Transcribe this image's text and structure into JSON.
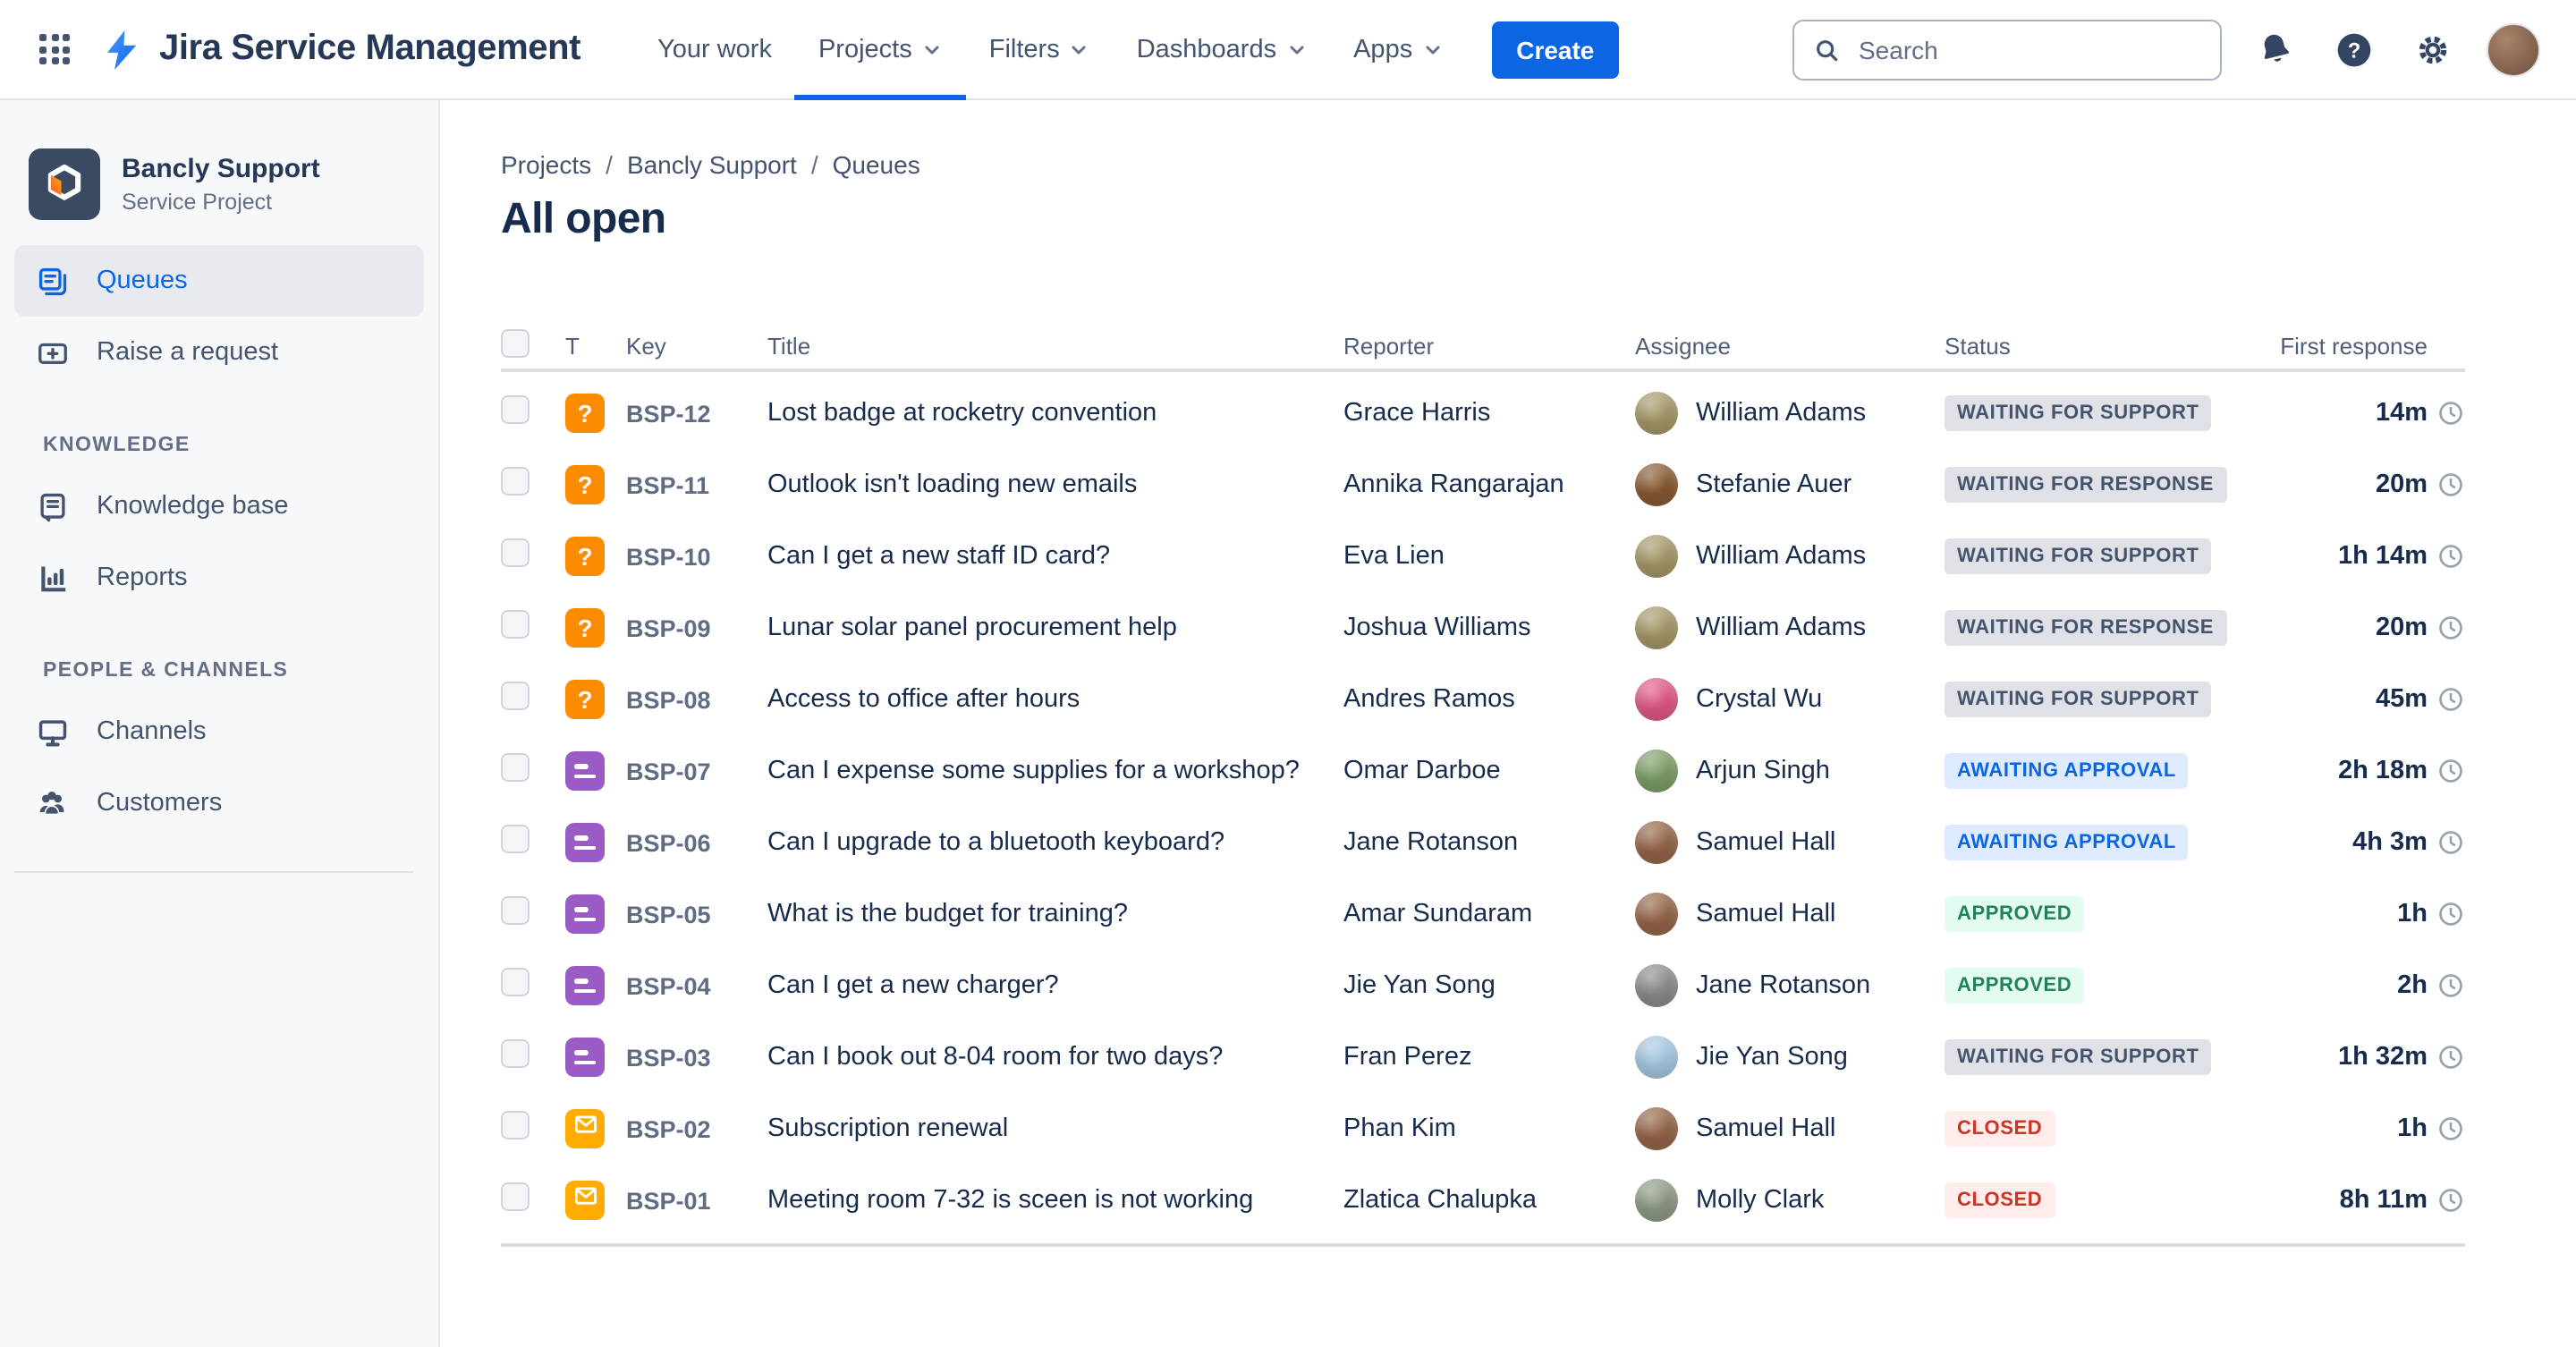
{
  "header": {
    "app_title": "Jira Service Management",
    "nav": [
      {
        "label": "Your work",
        "chevron": false,
        "active": false
      },
      {
        "label": "Projects",
        "chevron": true,
        "active": true
      },
      {
        "label": "Filters",
        "chevron": true,
        "active": false
      },
      {
        "label": "Dashboards",
        "chevron": true,
        "active": false
      },
      {
        "label": "Apps",
        "chevron": true,
        "active": false
      }
    ],
    "create_label": "Create",
    "search_placeholder": "Search"
  },
  "sidebar": {
    "project_name": "Bancly Support",
    "project_type": "Service Project",
    "primary_items": [
      {
        "label": "Queues",
        "active": true
      },
      {
        "label": "Raise a request",
        "active": false
      }
    ],
    "sections": [
      {
        "title": "KNOWLEDGE",
        "items": [
          {
            "label": "Knowledge base"
          },
          {
            "label": "Reports"
          }
        ]
      },
      {
        "title": "PEOPLE & CHANNELS",
        "items": [
          {
            "label": "Channels"
          },
          {
            "label": "Customers"
          }
        ]
      }
    ]
  },
  "breadcrumb": {
    "items": [
      "Projects",
      "Bancly Support",
      "Queues"
    ],
    "separator": "/"
  },
  "page_title": "All open",
  "brand": {
    "accent": "#0C66E4",
    "navy": "#253858"
  },
  "type_styles": {
    "question": {
      "bg": "#FC8B00"
    },
    "request": {
      "bg": "#9A5CC4"
    },
    "email": {
      "bg": "#FFAB00"
    }
  },
  "status_styles": {
    "neutral": {
      "bg": "#DFE1E6",
      "fg": "#44546F"
    },
    "info": {
      "bg": "#DEEBFF",
      "fg": "#0C66E4"
    },
    "success": {
      "bg": "#E3FCEF",
      "fg": "#1F845A"
    },
    "danger": {
      "bg": "#FFECEB",
      "fg": "#CA3521"
    }
  },
  "table": {
    "columns": {
      "type": "T",
      "key": "Key",
      "title": "Title",
      "reporter": "Reporter",
      "assignee": "Assignee",
      "status": "Status",
      "first_response": "First response"
    },
    "rows": [
      {
        "key": "BSP-12",
        "type": "question",
        "title": "Lost badge at rocketry convention",
        "reporter": "Grace Harris",
        "assignee": "William Adams",
        "avatar_color": "#A89A6A",
        "status": "WAITING FOR SUPPORT",
        "status_kind": "neutral",
        "first_response": "14m"
      },
      {
        "key": "BSP-11",
        "type": "question",
        "title": "Outlook isn't loading new emails",
        "reporter": "Annika Rangarajan",
        "assignee": "Stefanie Auer",
        "avatar_color": "#8A5A33",
        "status": "WAITING FOR RESPONSE",
        "status_kind": "neutral",
        "first_response": "20m"
      },
      {
        "key": "BSP-10",
        "type": "question",
        "title": "Can I get a new staff ID card?",
        "reporter": "Eva Lien",
        "assignee": "William Adams",
        "avatar_color": "#A89A6A",
        "status": "WAITING FOR SUPPORT",
        "status_kind": "neutral",
        "first_response": "1h 14m"
      },
      {
        "key": "BSP-09",
        "type": "question",
        "title": "Lunar solar panel procurement help",
        "reporter": "Joshua Williams",
        "assignee": "William Adams",
        "avatar_color": "#A89A6A",
        "status": "WAITING FOR RESPONSE",
        "status_kind": "neutral",
        "first_response": "20m"
      },
      {
        "key": "BSP-08",
        "type": "question",
        "title": "Access to office after hours",
        "reporter": "Andres Ramos",
        "assignee": "Crystal Wu",
        "avatar_color": "#E25A86",
        "status": "WAITING FOR SUPPORT",
        "status_kind": "neutral",
        "first_response": "45m"
      },
      {
        "key": "BSP-07",
        "type": "request",
        "title": "Can I expense some supplies for a workshop?",
        "reporter": "Omar Darboe",
        "assignee": "Arjun Singh",
        "avatar_color": "#7FA06A",
        "status": "AWAITING APPROVAL",
        "status_kind": "info",
        "first_response": "2h 18m"
      },
      {
        "key": "BSP-06",
        "type": "request",
        "title": "Can I upgrade to a bluetooth keyboard?",
        "reporter": "Jane Rotanson",
        "assignee": "Samuel Hall",
        "avatar_color": "#97664A",
        "status": "AWAITING APPROVAL",
        "status_kind": "info",
        "first_response": "4h 3m"
      },
      {
        "key": "BSP-05",
        "type": "request",
        "title": "What is the budget for training?",
        "reporter": "Amar Sundaram",
        "assignee": "Samuel Hall",
        "avatar_color": "#97664A",
        "status": "APPROVED",
        "status_kind": "success",
        "first_response": "1h"
      },
      {
        "key": "BSP-04",
        "type": "request",
        "title": "Can I get a new charger?",
        "reporter": "Jie Yan Song",
        "assignee": "Jane Rotanson",
        "avatar_color": "#8E8E8E",
        "status": "APPROVED",
        "status_kind": "success",
        "first_response": "2h"
      },
      {
        "key": "BSP-03",
        "type": "request",
        "title": "Can I book out 8-04 room for two days?",
        "reporter": "Fran Perez",
        "assignee": "Jie Yan Song",
        "avatar_color": "#A9CBE4",
        "status": "WAITING FOR SUPPORT",
        "status_kind": "neutral",
        "first_response": "1h 32m"
      },
      {
        "key": "BSP-02",
        "type": "email",
        "title": "Subscription renewal",
        "reporter": "Phan Kim",
        "assignee": "Samuel Hall",
        "avatar_color": "#97664A",
        "status": "CLOSED",
        "status_kind": "danger",
        "first_response": "1h"
      },
      {
        "key": "BSP-01",
        "type": "email",
        "title": "Meeting room 7-32 is sceen is not working",
        "reporter": "Zlatica Chalupka",
        "assignee": "Molly Clark",
        "avatar_color": "#909C86",
        "status": "CLOSED",
        "status_kind": "danger",
        "first_response": "8h 11m"
      }
    ]
  }
}
